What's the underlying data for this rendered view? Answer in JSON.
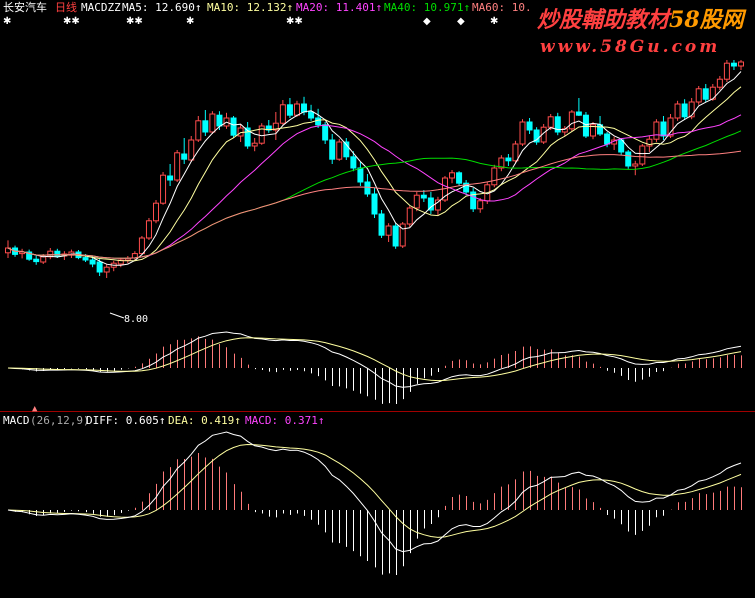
{
  "colors": {
    "bg": "#000000",
    "candle_up": "#ff4d4d",
    "candle_down": "#00ffff",
    "ma5": "#ffffff",
    "ma10": "#ffffa0",
    "ma20": "#ff44ff",
    "ma40": "#00dd00",
    "ma60": "#ff8080",
    "macd_pos": "#ff7a7a",
    "macd_neg": "#ffffff",
    "diff": "#ffffff",
    "dea": "#ffffa0",
    "divider": "#a00000",
    "watermark": "#ff4040"
  },
  "header": {
    "stock": "长安汽车",
    "period": "日线",
    "indicator": "MACDZZ",
    "ma5": "MA5: 12.690↑",
    "ma10": "MA10: 12.132↑",
    "ma20": "MA20: 11.401↑",
    "ma40": "MA40: 10.971↑",
    "ma60": "MA60: 10."
  },
  "watermark": {
    "line1": "炒股輔助教材",
    "line1_brand": "58股网",
    "line2": "www.58Gu.com"
  },
  "price_annotation": "8.00",
  "macd_header": {
    "name": "MACD",
    "params": "(26,12,9)",
    "diff": "DIFF: 0.605↑",
    "dea": "DEA: 0.419↑",
    "macd": "MACD: 0.371↑"
  },
  "chart_data": [
    {
      "type": "candlestick",
      "title": "长安汽车 日线",
      "ylim": [
        7.5,
        14.0
      ],
      "candles": [
        [
          9.18,
          9.49,
          9.05,
          9.3
        ],
        [
          9.3,
          9.36,
          9.08,
          9.14
        ],
        [
          9.16,
          9.28,
          9.04,
          9.2
        ],
        [
          9.2,
          9.26,
          8.98,
          9.02
        ],
        [
          9.02,
          9.12,
          8.88,
          8.96
        ],
        [
          8.95,
          9.15,
          8.9,
          9.08
        ],
        [
          9.08,
          9.3,
          9.02,
          9.22
        ],
        [
          9.22,
          9.28,
          9.05,
          9.1
        ],
        [
          9.1,
          9.22,
          9.0,
          9.15
        ],
        [
          9.12,
          9.26,
          9.05,
          9.2
        ],
        [
          9.2,
          9.25,
          9.02,
          9.06
        ],
        [
          9.06,
          9.15,
          8.95,
          9.0
        ],
        [
          9.0,
          9.1,
          8.82,
          8.9
        ],
        [
          8.95,
          9.02,
          8.6,
          8.7
        ],
        [
          8.7,
          8.9,
          8.55,
          8.82
        ],
        [
          8.82,
          8.98,
          8.72,
          8.92
        ],
        [
          8.9,
          9.06,
          8.82,
          9.0
        ],
        [
          9.0,
          9.1,
          8.92,
          9.05
        ],
        [
          9.05,
          9.22,
          9.0,
          9.16
        ],
        [
          9.16,
          9.6,
          9.12,
          9.55
        ],
        [
          9.55,
          10.05,
          9.5,
          9.98
        ],
        [
          9.98,
          10.5,
          9.92,
          10.42
        ],
        [
          10.42,
          11.2,
          10.38,
          11.12
        ],
        [
          11.1,
          11.4,
          10.85,
          11.0
        ],
        [
          11.0,
          11.75,
          10.95,
          11.68
        ],
        [
          11.65,
          12.05,
          11.4,
          11.52
        ],
        [
          11.5,
          12.1,
          11.45,
          12.0
        ],
        [
          12.0,
          12.6,
          11.95,
          12.48
        ],
        [
          12.48,
          12.75,
          12.1,
          12.2
        ],
        [
          12.2,
          12.72,
          12.15,
          12.65
        ],
        [
          12.62,
          12.72,
          12.25,
          12.35
        ],
        [
          12.35,
          12.68,
          12.28,
          12.55
        ],
        [
          12.55,
          12.6,
          12.05,
          12.12
        ],
        [
          12.1,
          12.38,
          11.95,
          12.3
        ],
        [
          12.3,
          12.45,
          11.78,
          11.85
        ],
        [
          11.85,
          12.05,
          11.72,
          11.92
        ],
        [
          11.92,
          12.42,
          11.88,
          12.35
        ],
        [
          12.35,
          12.5,
          12.18,
          12.25
        ],
        [
          12.25,
          12.7,
          12.0,
          12.42
        ],
        [
          12.42,
          13.0,
          12.38,
          12.88
        ],
        [
          12.88,
          13.05,
          12.55,
          12.62
        ],
        [
          12.62,
          12.98,
          12.58,
          12.9
        ],
        [
          12.9,
          13.08,
          12.62,
          12.7
        ],
        [
          12.7,
          12.88,
          12.48,
          12.55
        ],
        [
          12.55,
          12.78,
          12.3,
          12.38
        ],
        [
          12.38,
          12.45,
          11.9,
          12.0
        ],
        [
          12.0,
          12.15,
          11.4,
          11.52
        ],
        [
          11.52,
          12.02,
          11.48,
          11.95
        ],
        [
          11.95,
          12.05,
          11.5,
          11.58
        ],
        [
          11.58,
          11.72,
          11.22,
          11.3
        ],
        [
          11.3,
          11.45,
          10.85,
          10.95
        ],
        [
          10.95,
          11.15,
          10.58,
          10.65
        ],
        [
          10.65,
          10.8,
          10.05,
          10.15
        ],
        [
          10.15,
          10.25,
          9.55,
          9.62
        ],
        [
          9.62,
          9.92,
          9.45,
          9.85
        ],
        [
          9.85,
          9.92,
          9.28,
          9.35
        ],
        [
          9.35,
          9.95,
          9.3,
          9.9
        ],
        [
          9.9,
          10.35,
          9.82,
          10.3
        ],
        [
          10.3,
          10.7,
          10.22,
          10.62
        ],
        [
          10.62,
          10.75,
          10.45,
          10.55
        ],
        [
          10.55,
          10.7,
          10.15,
          10.25
        ],
        [
          10.25,
          10.58,
          10.12,
          10.5
        ],
        [
          10.5,
          11.1,
          10.45,
          11.05
        ],
        [
          11.05,
          11.25,
          10.92,
          11.18
        ],
        [
          11.18,
          11.22,
          10.85,
          10.92
        ],
        [
          10.92,
          11.0,
          10.62,
          10.7
        ],
        [
          10.7,
          10.8,
          10.2,
          10.28
        ],
        [
          10.28,
          10.55,
          10.18,
          10.48
        ],
        [
          10.48,
          10.95,
          10.4,
          10.88
        ],
        [
          10.88,
          11.38,
          10.82,
          11.3
        ],
        [
          11.3,
          11.62,
          11.22,
          11.55
        ],
        [
          11.55,
          11.65,
          11.35,
          11.48
        ],
        [
          11.48,
          11.98,
          11.42,
          11.9
        ],
        [
          11.9,
          12.52,
          11.85,
          12.45
        ],
        [
          12.45,
          12.55,
          12.15,
          12.25
        ],
        [
          12.25,
          12.32,
          11.88,
          11.95
        ],
        [
          11.95,
          12.4,
          11.9,
          12.32
        ],
        [
          12.32,
          12.65,
          12.25,
          12.58
        ],
        [
          12.58,
          12.68,
          12.12,
          12.2
        ],
        [
          12.2,
          12.35,
          12.1,
          12.28
        ],
        [
          12.28,
          12.75,
          12.22,
          12.7
        ],
        [
          12.7,
          13.05,
          12.6,
          12.62
        ],
        [
          12.62,
          12.7,
          12.05,
          12.1
        ],
        [
          12.1,
          12.45,
          12.02,
          12.38
        ],
        [
          12.38,
          12.6,
          12.1,
          12.15
        ],
        [
          12.15,
          12.2,
          11.82,
          11.9
        ],
        [
          11.9,
          12.08,
          11.75,
          12.0
        ],
        [
          12.0,
          12.05,
          11.62,
          11.7
        ],
        [
          11.7,
          11.75,
          11.28,
          11.35
        ],
        [
          11.35,
          11.48,
          11.12,
          11.4
        ],
        [
          11.4,
          11.9,
          11.35,
          11.85
        ],
        [
          11.85,
          12.1,
          11.7,
          12.02
        ],
        [
          12.02,
          12.52,
          11.95,
          12.45
        ],
        [
          12.45,
          12.6,
          12.0,
          12.1
        ],
        [
          12.1,
          12.65,
          12.05,
          12.55
        ],
        [
          12.55,
          12.98,
          12.48,
          12.9
        ],
        [
          12.9,
          13.02,
          12.5,
          12.58
        ],
        [
          12.58,
          13.05,
          12.52,
          12.95
        ],
        [
          12.95,
          13.35,
          12.88,
          13.28
        ],
        [
          13.28,
          13.4,
          12.95,
          13.02
        ],
        [
          13.02,
          13.4,
          12.98,
          13.32
        ],
        [
          13.32,
          13.6,
          13.25,
          13.52
        ],
        [
          13.52,
          14.0,
          13.45,
          13.92
        ],
        [
          13.92,
          14.0,
          13.75,
          13.85
        ],
        [
          13.85,
          14.0,
          13.75,
          13.95
        ]
      ],
      "moving_averages": [
        {
          "name": "MA5",
          "period": 5
        },
        {
          "name": "MA10",
          "period": 10
        },
        {
          "name": "MA20",
          "period": 20
        },
        {
          "name": "MA40",
          "period": 40
        },
        {
          "name": "MA60",
          "period": 60
        }
      ]
    },
    {
      "type": "bar",
      "title": "MACDZZ",
      "ylim": [
        -1.2,
        1.2
      ]
    },
    {
      "type": "bar",
      "title": "MACD (26,12,9)",
      "last_values": {
        "DIFF": 0.605,
        "DEA": 0.419,
        "MACD": 0.371
      }
    }
  ]
}
